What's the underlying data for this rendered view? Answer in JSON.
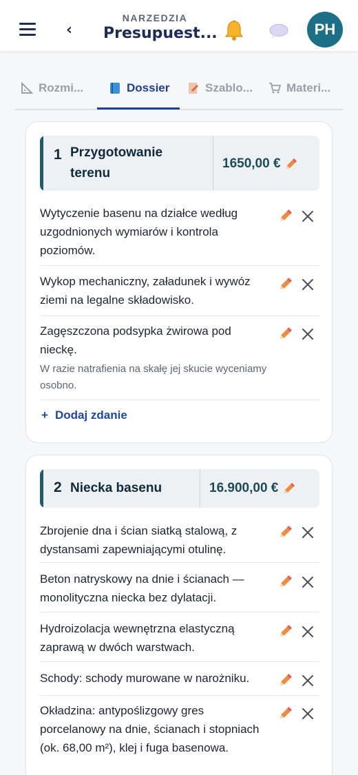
{
  "header": {
    "kicker": "NARZEDZIA",
    "title": "Presupuest...",
    "avatar_initials": "PH",
    "accent_color": "#1b6f87"
  },
  "tabs": [
    {
      "label": "Rozmi...",
      "icon": "ruler-icon"
    },
    {
      "label": "Dossier",
      "icon": "book-icon",
      "active": true
    },
    {
      "label": "Szablo...",
      "icon": "template-icon"
    },
    {
      "label": "Materi...",
      "icon": "cart-icon"
    }
  ],
  "sections": [
    {
      "number": "1",
      "title": "Przygotowanie terenu",
      "title_line1": "Przygotowanie",
      "title_line2": "terenu",
      "price": "1650,00 €",
      "items": [
        {
          "text": "Wytyczenie basenu na działce według uzgodnionych wymiarów i kontrola poziomów."
        },
        {
          "text": "Wykop mechaniczny, załadunek i wywóz ziemi na legalne składowisko."
        },
        {
          "text": "Zagęszczona podsypka żwirowa pod nieckę.",
          "note": "W razie natrafienia na skałę jej skucie wyceniamy osobno."
        }
      ],
      "add_label": "Dodaj zdanie"
    },
    {
      "number": "2",
      "title": "Niecka basenu",
      "price": "16.900,00 €",
      "items": [
        {
          "text": "Zbrojenie dna i ścian siatką stalową, z dystansami zapewniającymi otulinę."
        },
        {
          "text": "Beton natryskowy na dnie i ścianach — monolityczna niecka bez dylatacji."
        },
        {
          "text": "Hydroizolacja wewnętrzna elastyczną zaprawą w dwóch warstwach."
        },
        {
          "text": "Schody: schody murowane w narożniku."
        },
        {
          "text": "Okładzina: antypoślizgowy gres porcelanowy na dnie, ścianach i stopniach (ok. 68,00 m²), klej i fuga basenowa."
        }
      ]
    }
  ]
}
